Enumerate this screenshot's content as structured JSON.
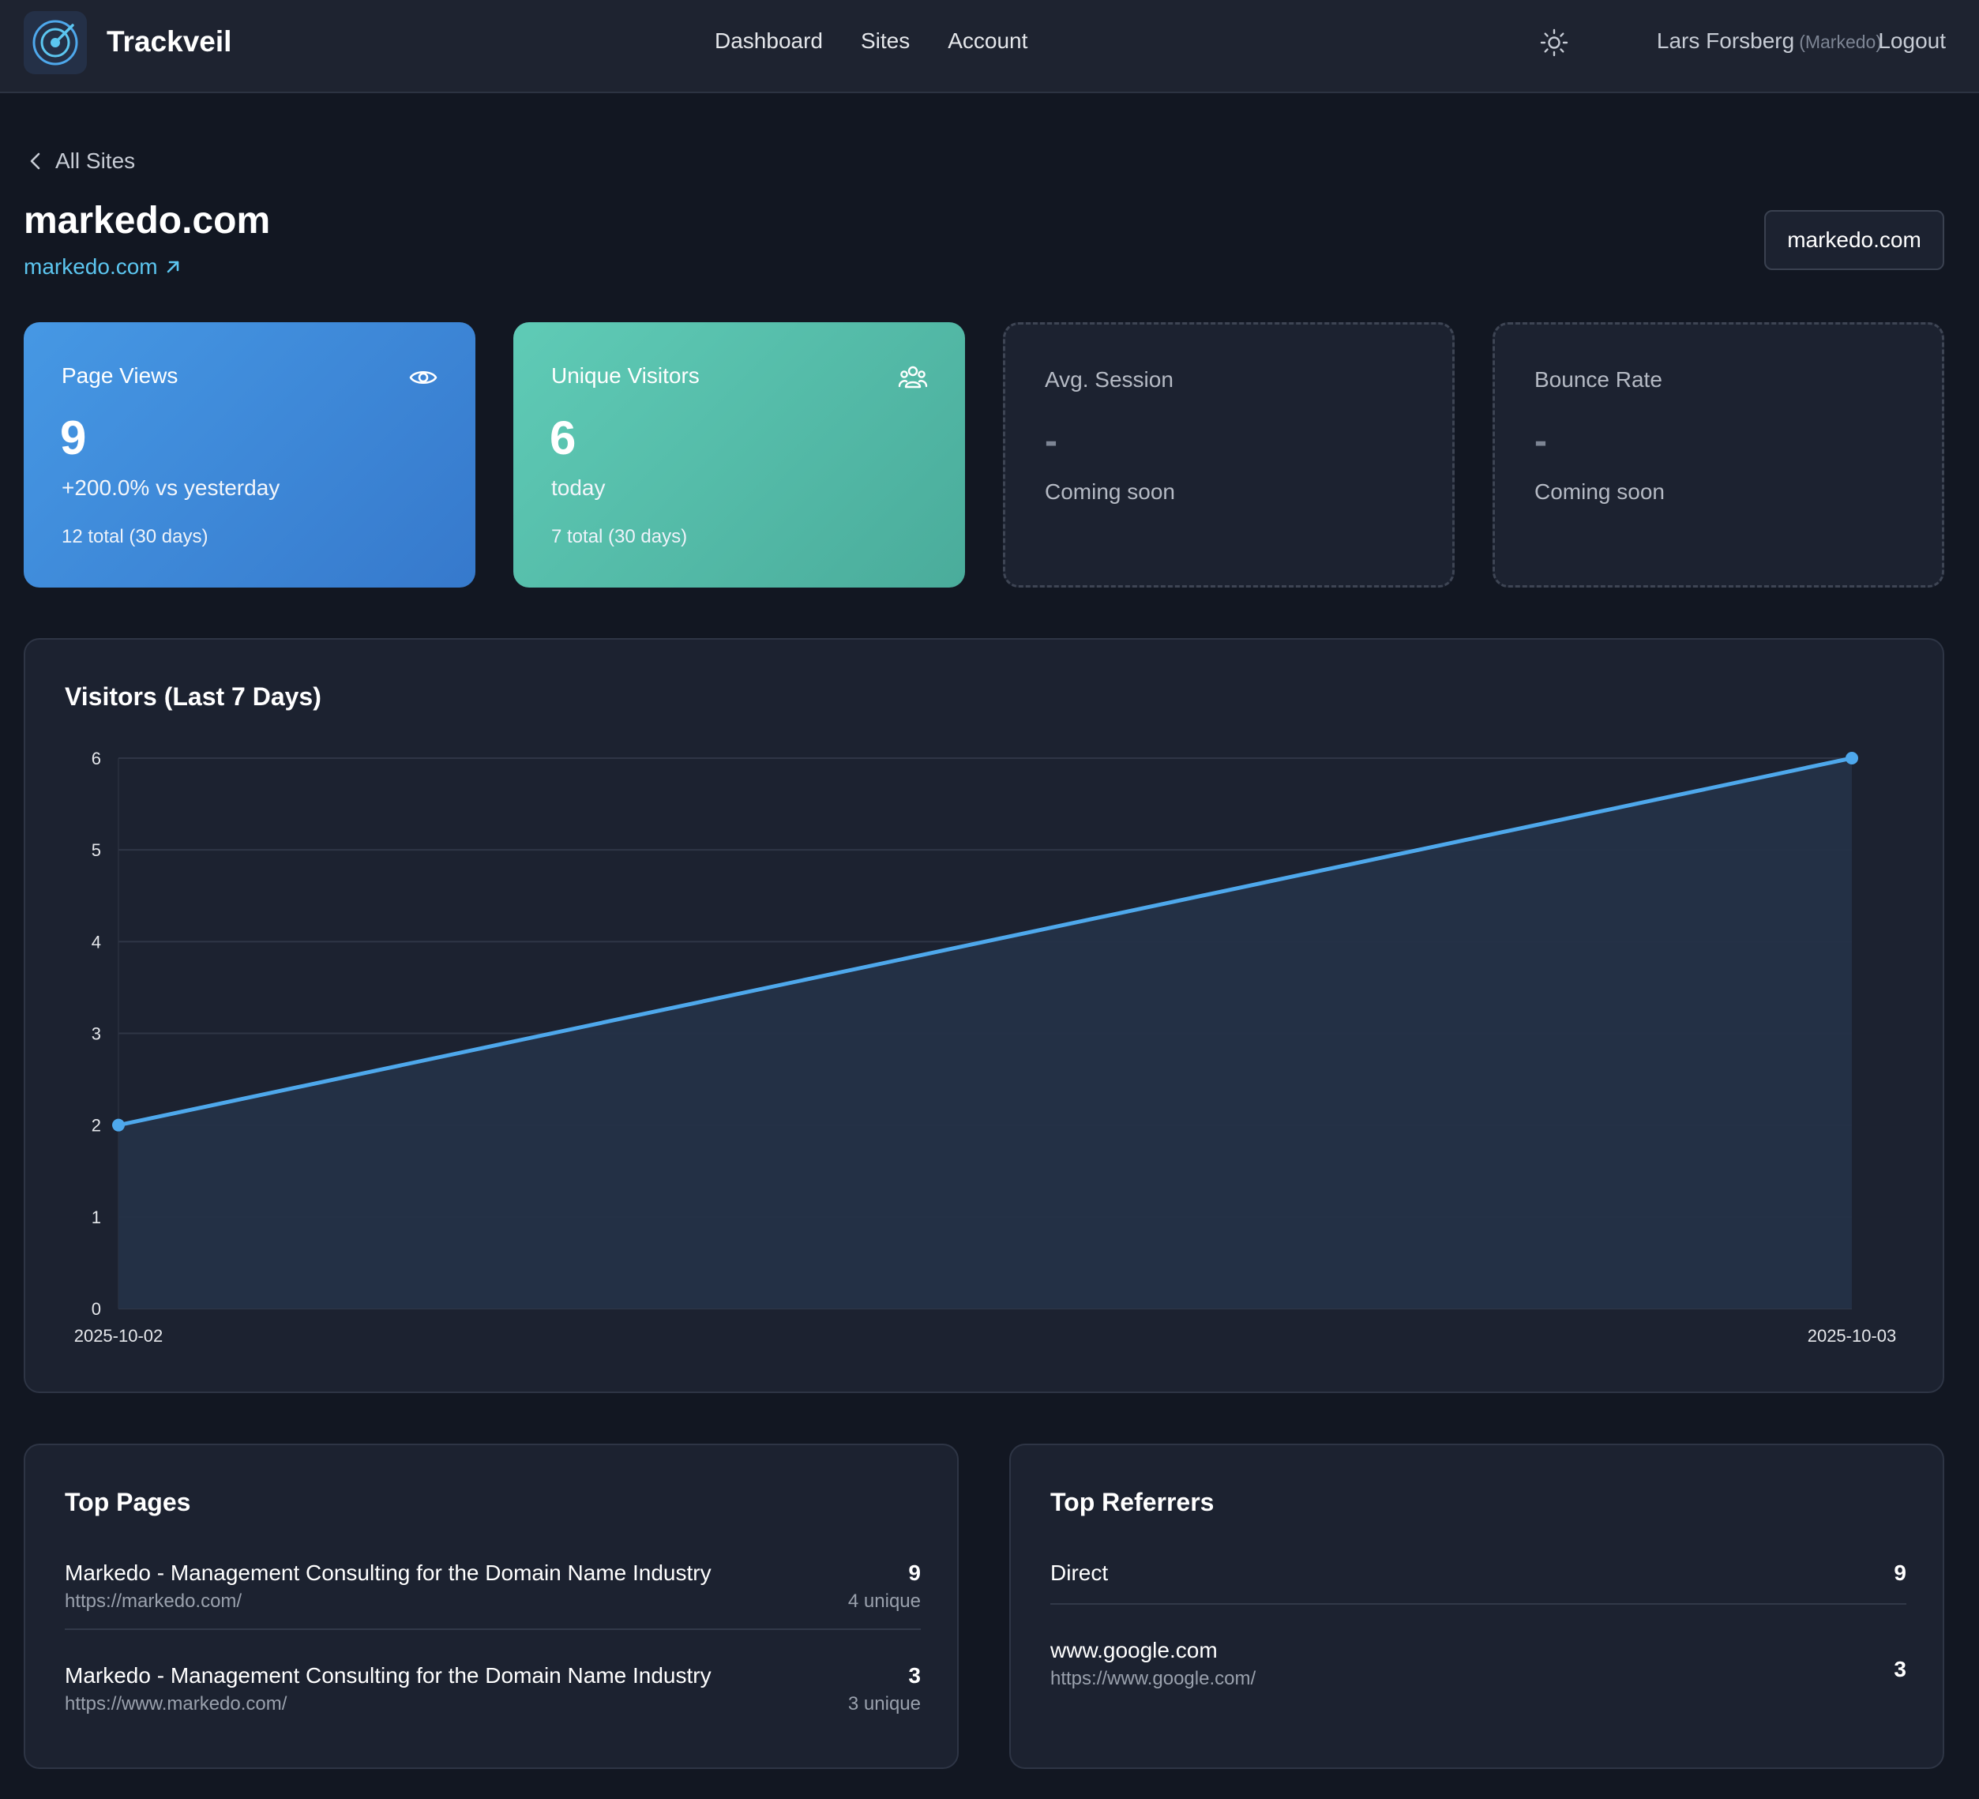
{
  "nav": {
    "brand": "Trackveil",
    "links": [
      "Dashboard",
      "Sites",
      "Account"
    ],
    "user_name": "Lars Forsberg",
    "user_org": "(Markedo)",
    "logout": "Logout"
  },
  "header": {
    "back_label": "All Sites",
    "site_title": "markedo.com",
    "site_link": "markedo.com",
    "site_selector": "markedo.com"
  },
  "stats": {
    "page_views": {
      "label": "Page Views",
      "value": "9",
      "change": "+200.0% vs yesterday",
      "total": "12 total (30 days)"
    },
    "unique_visitors": {
      "label": "Unique Visitors",
      "value": "6",
      "period": "today",
      "total": "7 total (30 days)"
    },
    "avg_session": {
      "label": "Avg. Session",
      "value": "-",
      "note": "Coming soon"
    },
    "bounce_rate": {
      "label": "Bounce Rate",
      "value": "-",
      "note": "Coming soon"
    }
  },
  "chart_data": {
    "type": "area",
    "title": "Visitors (Last 7 Days)",
    "x": [
      "2025-10-02",
      "2025-10-03"
    ],
    "values": [
      2,
      6
    ],
    "ylim": [
      0,
      6
    ],
    "yticks": [
      0,
      1,
      2,
      3,
      4,
      5,
      6
    ],
    "grid": true,
    "colors": {
      "line": "#4ea8ec",
      "fill": "#243247"
    }
  },
  "top_pages": {
    "title": "Top Pages",
    "items": [
      {
        "title": "Markedo - Management Consulting for the Domain Name Industry",
        "url": "https://markedo.com/",
        "views": "9",
        "unique": "4 unique"
      },
      {
        "title": "Markedo - Management Consulting for the Domain Name Industry",
        "url": "https://www.markedo.com/",
        "views": "3",
        "unique": "3 unique"
      }
    ]
  },
  "top_referrers": {
    "title": "Top Referrers",
    "items": [
      {
        "name": "Direct",
        "url": "",
        "count": "9"
      },
      {
        "name": "www.google.com",
        "url": "https://www.google.com/",
        "count": "3"
      }
    ]
  },
  "icons": [
    "radar-logo-icon",
    "sun-icon",
    "chevron-left-icon",
    "external-link-icon",
    "eye-icon",
    "users-icon"
  ]
}
